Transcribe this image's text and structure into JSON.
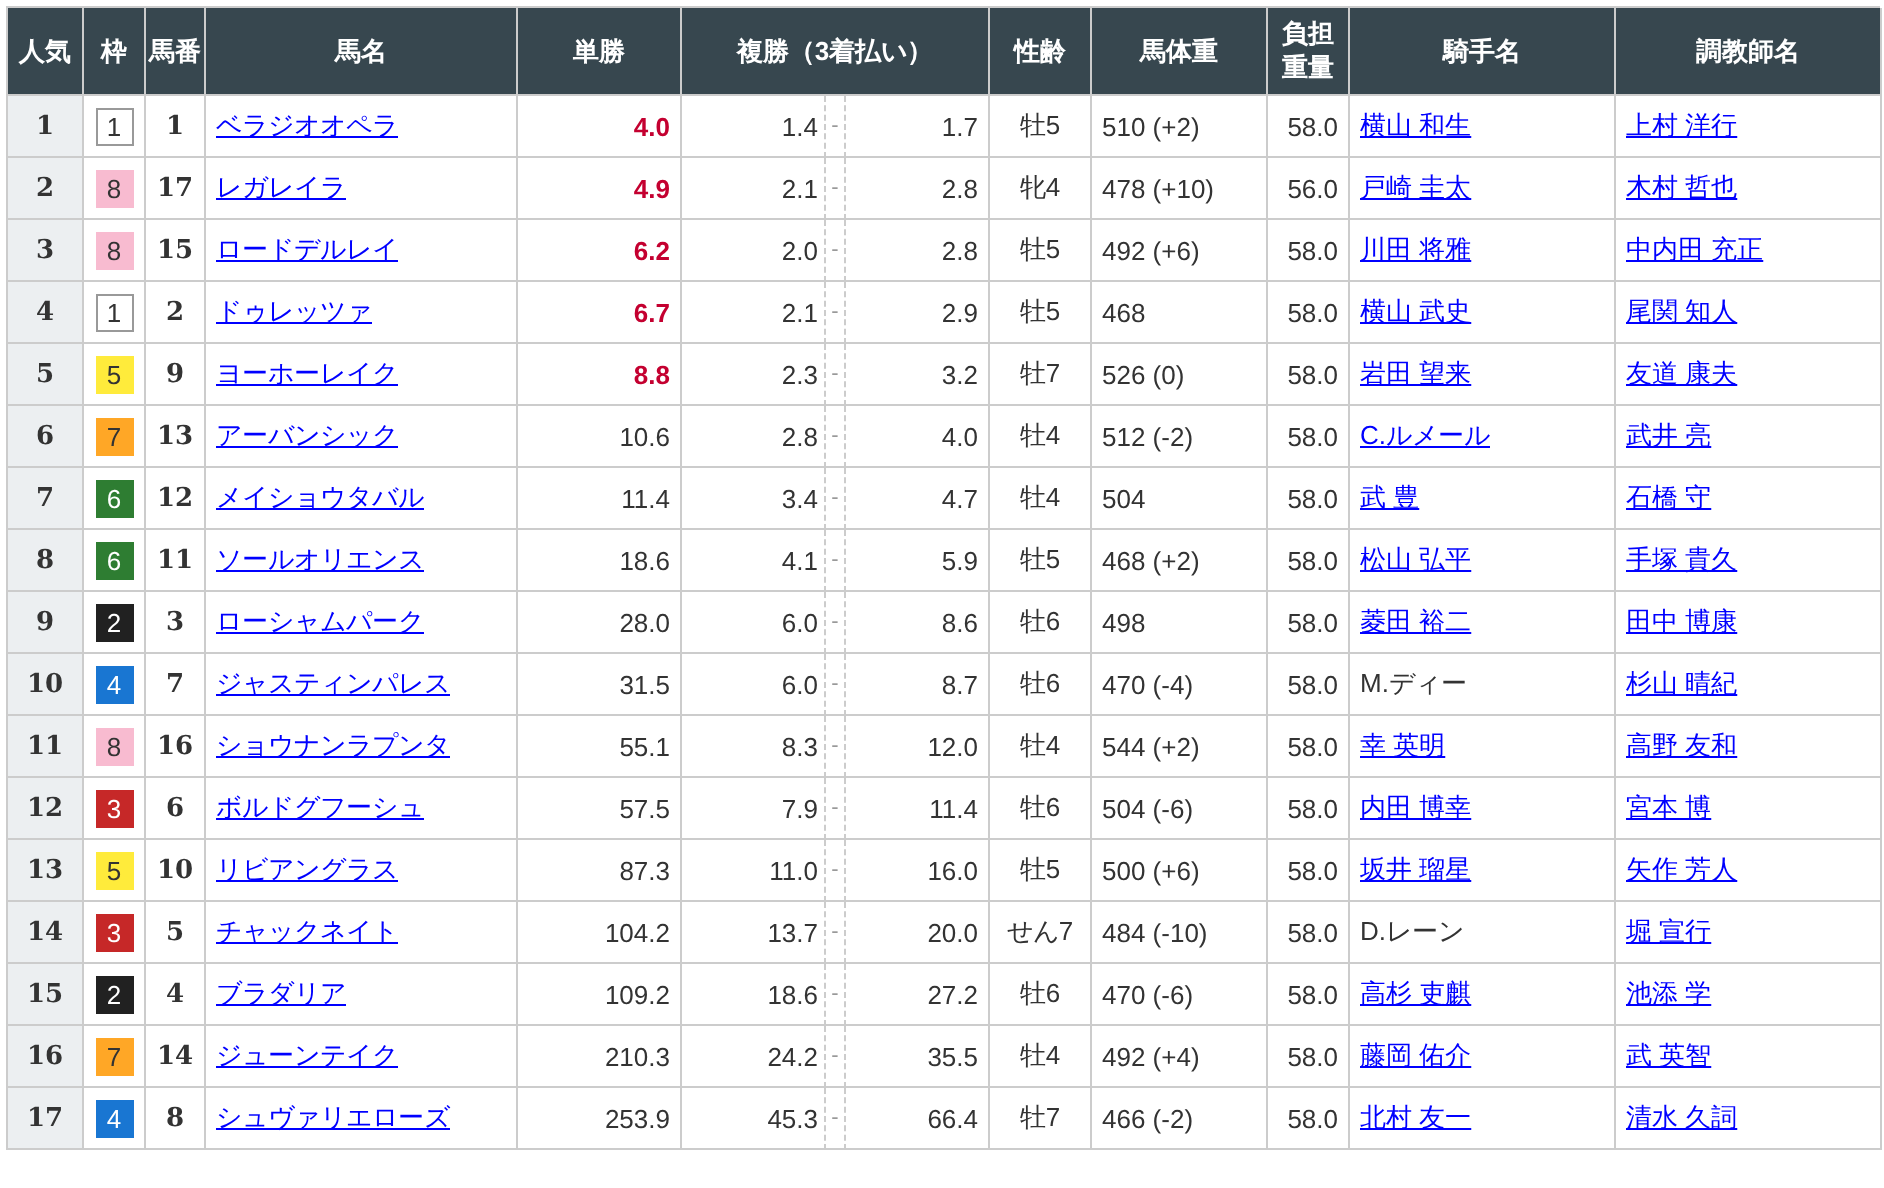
{
  "table": {
    "columns": [
      {
        "label": "人気"
      },
      {
        "label": "枠"
      },
      {
        "label": "馬番"
      },
      {
        "label": "馬名"
      },
      {
        "label": "単勝"
      },
      {
        "label": "複勝（3着払い）"
      },
      {
        "label": "性齢"
      },
      {
        "label": "馬体重"
      },
      {
        "label": "負担重量"
      },
      {
        "label": "騎手名"
      },
      {
        "label": "調教師名"
      }
    ],
    "rows": [
      {
        "rank": "1",
        "frame": {
          "number": "1",
          "color": "#ffffff"
        },
        "horse_number": "1",
        "horse": "ベラジオオペラ",
        "win": "4.0",
        "favorite": true,
        "place": {
          "min": "1.4",
          "separator": "-",
          "max": "1.7"
        },
        "sex_age": "牡5",
        "weight": "510 (+2)",
        "burden": "58.0",
        "jockey": {
          "name": "横山 和生",
          "link": true
        },
        "trainer": "上村 洋行"
      },
      {
        "rank": "2",
        "frame": {
          "number": "8",
          "color": "#f8bbd0"
        },
        "horse_number": "17",
        "horse": "レガレイラ",
        "win": "4.9",
        "favorite": true,
        "place": {
          "min": "2.1",
          "separator": "-",
          "max": "2.8"
        },
        "sex_age": "牝4",
        "weight": "478 (+10)",
        "burden": "56.0",
        "jockey": {
          "name": "戸崎 圭太",
          "link": true
        },
        "trainer": "木村 哲也"
      },
      {
        "rank": "3",
        "frame": {
          "number": "8",
          "color": "#f8bbd0"
        },
        "horse_number": "15",
        "horse": "ロードデルレイ",
        "win": "6.2",
        "favorite": true,
        "place": {
          "min": "2.0",
          "separator": "-",
          "max": "2.8"
        },
        "sex_age": "牡5",
        "weight": "492 (+6)",
        "burden": "58.0",
        "jockey": {
          "name": "川田 将雅",
          "link": true
        },
        "trainer": "中内田 充正"
      },
      {
        "rank": "4",
        "frame": {
          "number": "1",
          "color": "#ffffff"
        },
        "horse_number": "2",
        "horse": "ドゥレッツァ",
        "win": "6.7",
        "favorite": true,
        "place": {
          "min": "2.1",
          "separator": "-",
          "max": "2.9"
        },
        "sex_age": "牡5",
        "weight": "468",
        "burden": "58.0",
        "jockey": {
          "name": "横山 武史",
          "link": true
        },
        "trainer": "尾関 知人"
      },
      {
        "rank": "5",
        "frame": {
          "number": "5",
          "color": "#ffeb3b"
        },
        "horse_number": "9",
        "horse": "ヨーホーレイク",
        "win": "8.8",
        "favorite": true,
        "place": {
          "min": "2.3",
          "separator": "-",
          "max": "3.2"
        },
        "sex_age": "牡7",
        "weight": "526 (0)",
        "burden": "58.0",
        "jockey": {
          "name": "岩田 望来",
          "link": true
        },
        "trainer": "友道 康夫"
      },
      {
        "rank": "6",
        "frame": {
          "number": "7",
          "color": "#ffa726"
        },
        "horse_number": "13",
        "horse": "アーバンシック",
        "win": "10.6",
        "favorite": false,
        "place": {
          "min": "2.8",
          "separator": "-",
          "max": "4.0"
        },
        "sex_age": "牡4",
        "weight": "512 (-2)",
        "burden": "58.0",
        "jockey": {
          "name": "C.ルメール",
          "link": true
        },
        "trainer": "武井 亮"
      },
      {
        "rank": "7",
        "frame": {
          "number": "6",
          "color": "#2e7d32"
        },
        "horse_number": "12",
        "horse": "メイショウタバル",
        "win": "11.4",
        "favorite": false,
        "place": {
          "min": "3.4",
          "separator": "-",
          "max": "4.7"
        },
        "sex_age": "牡4",
        "weight": "504",
        "burden": "58.0",
        "jockey": {
          "name": "武 豊",
          "link": true
        },
        "trainer": "石橋 守"
      },
      {
        "rank": "8",
        "frame": {
          "number": "6",
          "color": "#2e7d32"
        },
        "horse_number": "11",
        "horse": "ソールオリエンス",
        "win": "18.6",
        "favorite": false,
        "place": {
          "min": "4.1",
          "separator": "-",
          "max": "5.9"
        },
        "sex_age": "牡5",
        "weight": "468 (+2)",
        "burden": "58.0",
        "jockey": {
          "name": "松山 弘平",
          "link": true
        },
        "trainer": "手塚 貴久"
      },
      {
        "rank": "9",
        "frame": {
          "number": "2",
          "color": "#212121"
        },
        "horse_number": "3",
        "horse": "ローシャムパーク",
        "win": "28.0",
        "favorite": false,
        "place": {
          "min": "6.0",
          "separator": "-",
          "max": "8.6"
        },
        "sex_age": "牡6",
        "weight": "498",
        "burden": "58.0",
        "jockey": {
          "name": "菱田 裕二",
          "link": true
        },
        "trainer": "田中 博康"
      },
      {
        "rank": "10",
        "frame": {
          "number": "4",
          "color": "#1976d2"
        },
        "horse_number": "7",
        "horse": "ジャスティンパレス",
        "win": "31.5",
        "favorite": false,
        "place": {
          "min": "6.0",
          "separator": "-",
          "max": "8.7"
        },
        "sex_age": "牡6",
        "weight": "470 (-4)",
        "burden": "58.0",
        "jockey": {
          "name": "M.ディー",
          "link": false
        },
        "trainer": "杉山 晴紀"
      },
      {
        "rank": "11",
        "frame": {
          "number": "8",
          "color": "#f8bbd0"
        },
        "horse_number": "16",
        "horse": "ショウナンラプンタ",
        "win": "55.1",
        "favorite": false,
        "place": {
          "min": "8.3",
          "separator": "-",
          "max": "12.0"
        },
        "sex_age": "牡4",
        "weight": "544 (+2)",
        "burden": "58.0",
        "jockey": {
          "name": "幸 英明",
          "link": true
        },
        "trainer": "高野 友和"
      },
      {
        "rank": "12",
        "frame": {
          "number": "3",
          "color": "#c62828"
        },
        "horse_number": "6",
        "horse": "ボルドグフーシュ",
        "win": "57.5",
        "favorite": false,
        "place": {
          "min": "7.9",
          "separator": "-",
          "max": "11.4"
        },
        "sex_age": "牡6",
        "weight": "504 (-6)",
        "burden": "58.0",
        "jockey": {
          "name": "内田 博幸",
          "link": true
        },
        "trainer": "宮本 博"
      },
      {
        "rank": "13",
        "frame": {
          "number": "5",
          "color": "#ffeb3b"
        },
        "horse_number": "10",
        "horse": "リビアングラス",
        "win": "87.3",
        "favorite": false,
        "place": {
          "min": "11.0",
          "separator": "-",
          "max": "16.0"
        },
        "sex_age": "牡5",
        "weight": "500 (+6)",
        "burden": "58.0",
        "jockey": {
          "name": "坂井 瑠星",
          "link": true
        },
        "trainer": "矢作 芳人"
      },
      {
        "rank": "14",
        "frame": {
          "number": "3",
          "color": "#c62828"
        },
        "horse_number": "5",
        "horse": "チャックネイト",
        "win": "104.2",
        "favorite": false,
        "place": {
          "min": "13.7",
          "separator": "-",
          "max": "20.0"
        },
        "sex_age": "せん7",
        "weight": "484 (-10)",
        "burden": "58.0",
        "jockey": {
          "name": "D.レーン",
          "link": false
        },
        "trainer": "堀 宣行"
      },
      {
        "rank": "15",
        "frame": {
          "number": "2",
          "color": "#212121"
        },
        "horse_number": "4",
        "horse": "ブラダリア",
        "win": "109.2",
        "favorite": false,
        "place": {
          "min": "18.6",
          "separator": "-",
          "max": "27.2"
        },
        "sex_age": "牡6",
        "weight": "470 (-6)",
        "burden": "58.0",
        "jockey": {
          "name": "高杉 吏麒",
          "link": true
        },
        "trainer": "池添 学"
      },
      {
        "rank": "16",
        "frame": {
          "number": "7",
          "color": "#ffa726"
        },
        "horse_number": "14",
        "horse": "ジューンテイク",
        "win": "210.3",
        "favorite": false,
        "place": {
          "min": "24.2",
          "separator": "-",
          "max": "35.5"
        },
        "sex_age": "牡4",
        "weight": "492 (+4)",
        "burden": "58.0",
        "jockey": {
          "name": "藤岡 佑介",
          "link": true
        },
        "trainer": "武 英智"
      },
      {
        "rank": "17",
        "frame": {
          "number": "4",
          "color": "#1976d2"
        },
        "horse_number": "8",
        "horse": "シュヴァリエローズ",
        "win": "253.9",
        "favorite": false,
        "place": {
          "min": "45.3",
          "separator": "-",
          "max": "66.4"
        },
        "sex_age": "牡7",
        "weight": "466 (-2)",
        "burden": "58.0",
        "jockey": {
          "name": "北村 友一",
          "link": true
        },
        "trainer": "清水 久詞"
      }
    ]
  }
}
